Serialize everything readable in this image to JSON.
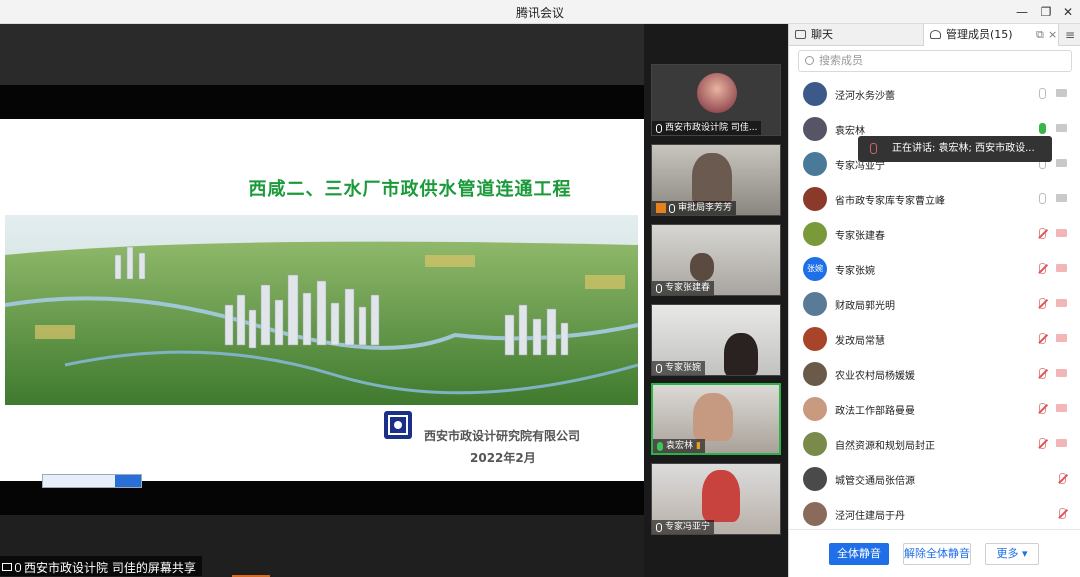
{
  "window": {
    "title": "腾讯会议"
  },
  "slide": {
    "title": "西咸二、三水厂市政供水管道连通工程",
    "company": "西安市政设计研究院有限公司",
    "date": "2022年2月"
  },
  "share": {
    "label": "西安市政设计院 司佳的屏幕共享"
  },
  "videos": [
    {
      "label": "西安市政设计院 司佳..."
    },
    {
      "label": "审批局李芳芳"
    },
    {
      "label": "专家张建春"
    },
    {
      "label": "专家张婉"
    },
    {
      "label": "袁宏林"
    },
    {
      "label": "专家冯亚宁"
    }
  ],
  "panel": {
    "tabs": {
      "chat": "聊天",
      "members": "管理成员(15)"
    },
    "search_placeholder": "搜索成员",
    "members": [
      {
        "name": "泾河水务沙蕾",
        "mic": "off",
        "cam": "off"
      },
      {
        "name": "袁宏林",
        "mic": "on",
        "cam": "off"
      },
      {
        "name": "专家冯亚宁",
        "mic": "off",
        "cam": "off"
      },
      {
        "name": "省市政专家库专家曹立峰",
        "mic": "off",
        "cam": "off"
      },
      {
        "name": "专家张建春",
        "mic": "muted",
        "cam": "muted"
      },
      {
        "name": "专家张婉",
        "avatar_text": "张婉",
        "mic": "muted",
        "cam": "muted"
      },
      {
        "name": "财政局郭光明",
        "mic": "muted",
        "cam": "muted"
      },
      {
        "name": "发改局常慧",
        "mic": "muted",
        "cam": "muted"
      },
      {
        "name": "农业农村局杨媛媛",
        "mic": "muted",
        "cam": "muted"
      },
      {
        "name": "政法工作部路曼曼",
        "mic": "muted",
        "cam": "muted"
      },
      {
        "name": "自然资源和规划局封正",
        "mic": "muted",
        "cam": "muted"
      },
      {
        "name": "城管交通局张倍源",
        "mic": "muted",
        "cam": "none"
      },
      {
        "name": "泾河住建局于丹",
        "mic": "muted",
        "cam": "none"
      }
    ],
    "speaking_tooltip": "正在讲话: 袁宏林; 西安市政设...",
    "buttons": {
      "mute_all": "全体静音",
      "unmute_all": "解除全体静音",
      "more": "更多 ▾"
    }
  }
}
